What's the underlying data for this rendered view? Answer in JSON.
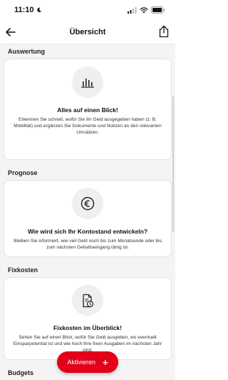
{
  "status_bar": {
    "time": "11:10"
  },
  "header": {
    "title": "Übersicht"
  },
  "sections": [
    {
      "header": "Auswertung",
      "card_title": "Alles auf einen Blick!",
      "card_text": "Erkennen Sie schnell, wofür Sie Ihr Geld ausgegeben haben (z. B. Mobilität) und ergänzen Sie Dokumente und Notizen an den relevanten Umsätzen.",
      "icon": "bar-chart-icon"
    },
    {
      "header": "Prognose",
      "card_title": "Wie wird sich Ihr Kontostand entwickeln?",
      "card_text": "Bleiben Sie informiert, wie viel Geld noch bis zum Monatsende oder bis zum nächsten Gehaltseingang übrig ist.",
      "icon": "euro-icon"
    },
    {
      "header": "Fixkosten",
      "card_title": "Fixkosten im Überblick!",
      "card_text": "Sehen Sie auf einen Blick, wofür Sie Geld ausgeben, wo eventuell Einsparpotential ist und wie hoch Ihre fixen Ausgaben im nächsten Jahr sind.",
      "icon": "fixed-cost-document-icon"
    },
    {
      "header": "Budgets"
    }
  ],
  "activate_button": {
    "label": "Aktivieren"
  },
  "colors": {
    "accent": "#e2001a",
    "background": "#f4f4f4"
  }
}
